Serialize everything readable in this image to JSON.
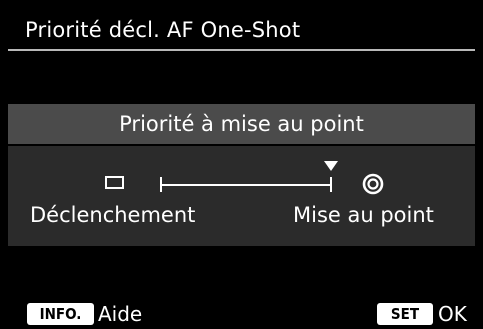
{
  "menu": {
    "title": "Priorité décl. AF One-Shot"
  },
  "setting": {
    "current_value": "Priorité à mise au point"
  },
  "slider": {
    "left_label": "Déclenchement",
    "right_label": "Mise au point",
    "position_fraction": 1.0,
    "left_icon": "release-square-icon",
    "right_icon": "focus-target-icon"
  },
  "footer": {
    "info_key": "INFO.",
    "info_action": "Aide",
    "set_key": "SET",
    "set_action": "OK"
  },
  "colors": {
    "background": "#000000",
    "selected_bar": "#4b4b4b",
    "panel": "#2b2b2b",
    "rule": "#b9b9b9",
    "text": "#ffffff"
  }
}
